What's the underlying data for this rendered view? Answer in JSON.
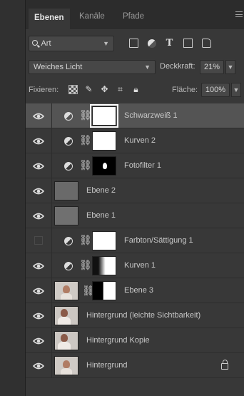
{
  "tabs": [
    {
      "label": "Ebenen",
      "active": true
    },
    {
      "label": "Kanäle",
      "active": false
    },
    {
      "label": "Pfade",
      "active": false
    }
  ],
  "filter": {
    "label": "Art",
    "icons": [
      "image-filter-icon",
      "adjustment-filter-icon",
      "type-filter-icon",
      "shape-filter-icon",
      "smart-object-filter-icon"
    ]
  },
  "blend": {
    "mode": "Weiches Licht",
    "opacity_label": "Deckkraft:",
    "opacity_value": "21%"
  },
  "lock": {
    "label": "Fixieren:",
    "fill_label": "Fläche:",
    "fill_value": "100%"
  },
  "layers": [
    {
      "name": "Schwarzweiß 1",
      "visible": true,
      "selected": true
    },
    {
      "name": "Kurven 2",
      "visible": true
    },
    {
      "name": "Fotofilter 1",
      "visible": true
    },
    {
      "name": "Ebene 2",
      "visible": true
    },
    {
      "name": "Ebene 1",
      "visible": true
    },
    {
      "name": "Farbton/Sättigung 1",
      "visible": false
    },
    {
      "name": "Kurven 1",
      "visible": true
    },
    {
      "name": "Ebene 3",
      "visible": true
    },
    {
      "name": "Hintergrund (leichte Sichtbarkeit)",
      "visible": true
    },
    {
      "name": "Hintergrund Kopie",
      "visible": true
    },
    {
      "name": "Hintergrund",
      "visible": true,
      "locked": true
    }
  ],
  "colors": {
    "panel": "#383838",
    "selected_row": "#545454",
    "tabbar": "#2c2c2c"
  }
}
